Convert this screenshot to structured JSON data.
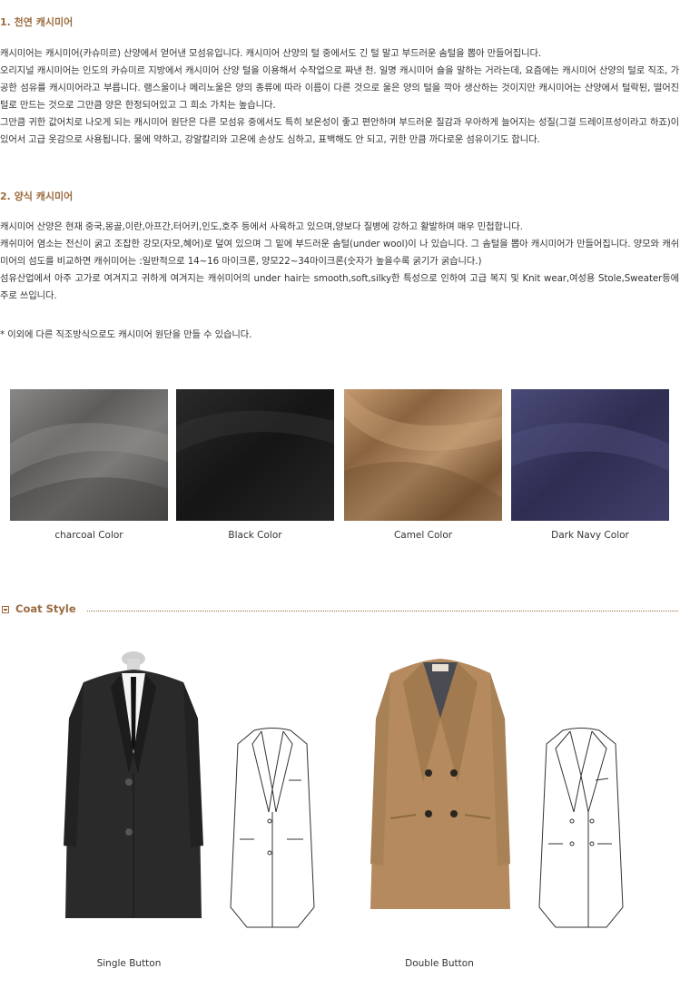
{
  "section1": {
    "title": "1. 천연 캐시미어",
    "paragraphs": [
      "캐시미어는 캐시미어(카슈미르) 산양에서 얻어낸 모섬유입니다. 캐시미어 산양의 털 중에서도 긴 털 말고 부드러운 솜털을 뽑아 만들어집니다.",
      "오리지널 캐시미어는 인도의 카슈미르 지방에서 캐시미어 산양 털을 이용해서 수작업으로 짜낸 천. 일명 캐시미어 숄을 말하는 거라는데, 요즘에는 캐시미어 산양의 털로 직조, 가공한 섬유를 캐시미어라고 부릅니다. 램스울이나 메리노울은 양의 종류에 따라 이름이 다른 것으로 울은 양의 털을 깍아 생산하는 것이지만 캐시미어는 산양에서 털락된, 떨어진 털로 만드는 것으로 그만큼 양은 한정되어있고 그 희소 가치는 높습니다.",
      "그만큼 귀한 값어치로 나오게 되는 캐시미어 원단은 다른 모섬유 중에서도 특히 보온성이 좋고 편안하며 부드러운 질감과 우아하게 늘어지는 성질(그걸 드레이프성이라고 하죠)이 있어서 고급 옷감으로 사용됩니다. 물에 약하고, 강알칼리와 고온에 손상도 심하고, 표백해도 안 되고, 귀한 만큼 까다로운 섬유이기도 합니다."
    ]
  },
  "section2": {
    "title": "2. 양식 캐시미어",
    "paragraphs": [
      "캐시미어 산양은 현재 중국,몽골,이란,아프간,터어키,인도,호주 등에서 사육하고 있으며,양보다 질병에 강하고 활발하며 매우 민첩합니다.",
      "캐쉬미어 염소는 전신이 굵고 조잡한 강모(자모,혜어)로 덮여 있으며 그 밑에 부드러운 솜털(under wool)이 나 있습니다. 그 솜털을 뽑아 캐시미어가 만들어집니다. 양모와 캐쉬미어의 섬도를 비교하면 캐쉬미어는 :일반적으로 14~16 마이크론, 양모22~34마이크론(숫자가 높을수록 굵기가 굵습니다.)",
      "섬유산업에서 아주 고가로 여겨지고 귀하게 여겨지는 캐쉬미어의 under hair는 smooth,soft,silky한 특성으로 인하여 고급 복지 및 Knit wear,여성용 Stole,Sweater등에 주로 쓰입니다."
    ],
    "note": "* 이외에 다른 직조방식으로도 캐시미어 원단을 만들 수 있습니다."
  },
  "swatches": [
    {
      "caption": "charcoal Color",
      "color": "#6e6c6a"
    },
    {
      "caption": "Black Color",
      "color": "#1e1e1e"
    },
    {
      "caption": "Camel Color",
      "color": "#a27b54"
    },
    {
      "caption": "Dark Navy Color",
      "color": "#36365e"
    }
  ],
  "coat_style": {
    "heading": "Coat Style",
    "items": [
      {
        "caption": "Single Button"
      },
      {
        "caption": "Double Button"
      }
    ]
  }
}
